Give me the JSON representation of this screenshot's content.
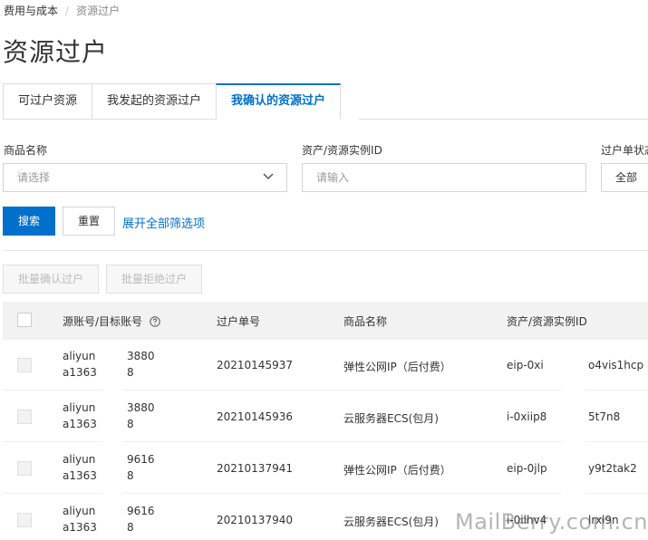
{
  "breadcrumb": {
    "root": "费用与成本",
    "separator": "/",
    "current": "资源过户"
  },
  "page_title": "资源过户",
  "tabs": [
    {
      "label": "可过户资源",
      "active": false
    },
    {
      "label": "我发起的资源过户",
      "active": false
    },
    {
      "label": "我确认的资源过户",
      "active": true
    }
  ],
  "filters": {
    "product": {
      "label": "商品名称",
      "placeholder": "请选择"
    },
    "instance": {
      "label": "资产/资源实例ID",
      "placeholder": "请输入"
    },
    "status": {
      "label": "过户单状态",
      "value": "全部"
    }
  },
  "actions": {
    "search": "搜索",
    "reset": "重置",
    "expand": "展开全部筛选项"
  },
  "batch": {
    "confirm": "批量确认过户",
    "reject": "批量拒绝过户"
  },
  "table": {
    "columns": [
      "源账号/目标账号",
      "过户单号",
      "商品名称",
      "资产/资源实例ID"
    ],
    "rows": [
      {
        "acct1": "aliyun",
        "acct1_tail": "3880",
        "acct2": "a1363",
        "acct2_tail": "8",
        "order": "20210145937",
        "product": "弹性公网IP（后付费）",
        "inst_a": "eip-0xi",
        "inst_b": "o4vis1hcp"
      },
      {
        "acct1": "aliyun",
        "acct1_tail": "3880",
        "acct2": "a1363",
        "acct2_tail": "8",
        "order": "20210145936",
        "product": "云服务器ECS(包月)",
        "inst_a": "i-0xiip8",
        "inst_b": "5t7n8"
      },
      {
        "acct1": "aliyun",
        "acct1_tail": "9616",
        "acct2": "a1363",
        "acct2_tail": "8",
        "order": "20210137941",
        "product": "弹性公网IP（后付费）",
        "inst_a": "eip-0jlp",
        "inst_b": "y9t2tak2"
      },
      {
        "acct1": "aliyun",
        "acct1_tail": "9616",
        "acct2": "a1363",
        "acct2_tail": "8",
        "order": "20210137940",
        "product": "云服务器ECS(包月)",
        "inst_a": "i-0ilhv4",
        "inst_b": "lrxl9n"
      }
    ]
  },
  "watermark": "MailBerry.com.cn",
  "colors": {
    "primary": "#0070cc",
    "header_bg": "#f2f2f2",
    "border": "#d4d4d4"
  }
}
